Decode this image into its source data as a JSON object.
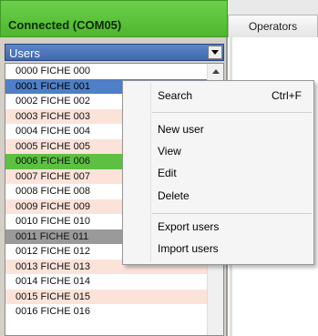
{
  "status": {
    "text": "Connected (COM05)",
    "color": "#4fb62f"
  },
  "tabs": [
    {
      "label": "Operators"
    }
  ],
  "users_combo": {
    "selected": "Users"
  },
  "users": [
    {
      "label": "0000 FICHE 000",
      "style": ""
    },
    {
      "label": "0001 FICHE 001",
      "style": "sel-blue"
    },
    {
      "label": "0002 FICHE 002",
      "style": ""
    },
    {
      "label": "0003 FICHE 003",
      "style": "alt"
    },
    {
      "label": "0004 FICHE 004",
      "style": ""
    },
    {
      "label": "0005 FICHE 005",
      "style": "alt"
    },
    {
      "label": "0006 FICHE 006",
      "style": "sel-green"
    },
    {
      "label": "0007 FICHE 007",
      "style": "alt"
    },
    {
      "label": "0008 FICHE 008",
      "style": ""
    },
    {
      "label": "0009 FICHE 009",
      "style": "alt"
    },
    {
      "label": "0010 FICHE 010",
      "style": ""
    },
    {
      "label": "0011 FICHE 011",
      "style": "sel-gray"
    },
    {
      "label": "0012 FICHE 012",
      "style": ""
    },
    {
      "label": "0013 FICHE 013",
      "style": "alt"
    },
    {
      "label": "0014 FICHE 014",
      "style": ""
    },
    {
      "label": "0015 FICHE 015",
      "style": "alt"
    },
    {
      "label": "0016 FICHE 016",
      "style": ""
    }
  ],
  "context_menu": {
    "search": {
      "label": "Search",
      "shortcut": "Ctrl+F"
    },
    "new_user": "New user",
    "view": "View",
    "edit": "Edit",
    "delete": "Delete",
    "export_users": "Export users",
    "import_users": "Import users"
  },
  "icons": {
    "combo_arrow": "chevron-down-icon",
    "scroll_up": "chevron-up-icon"
  }
}
